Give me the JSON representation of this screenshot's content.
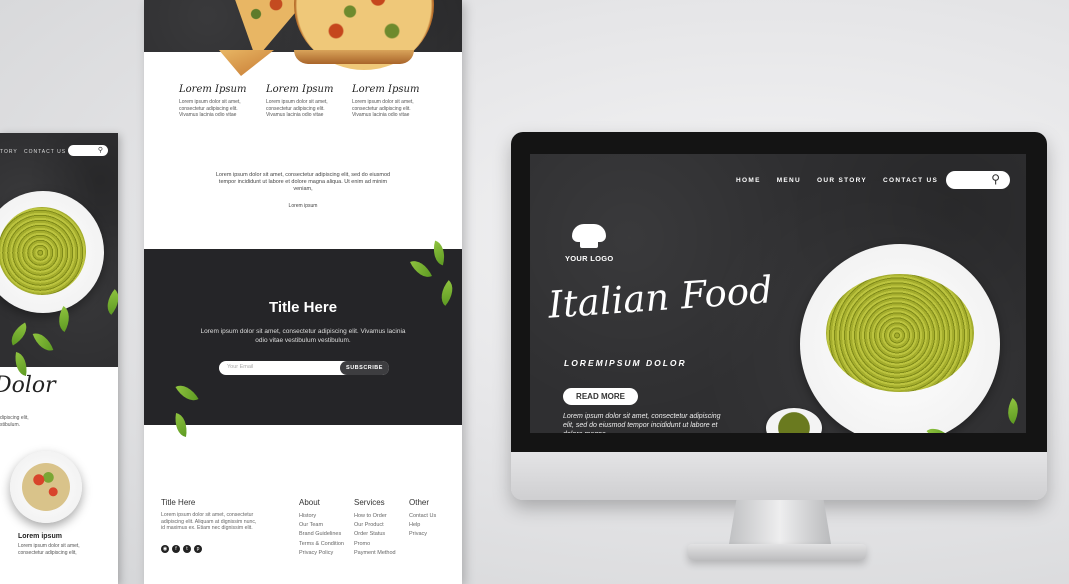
{
  "left_mockup": {
    "nav_partial": "TORY",
    "nav_contact": "CONTACT US",
    "dolor_partial": "Dolor",
    "body_partial_1": "dipiscing elit,",
    "body_partial_2": "stibulum.",
    "product_title": "Lorem ipsum",
    "product_text_1": "Lorem ipsum dolor sit amet,",
    "product_text_2": "consectetur adipiscing elit,"
  },
  "middle_mockup": {
    "features": [
      {
        "title": "Lorem Ipsum",
        "text": "Lorem ipsum dolor sit amet, consectetur adipiscing elit. Vivamus lacinia odio vitae"
      },
      {
        "title": "Lorem Ipsum",
        "text": "Lorem ipsum dolor sit amet, consectetur adipiscing elit. Vivamus lacinia odio vitae"
      },
      {
        "title": "Lorem Ipsum",
        "text": "Lorem ipsum dolor sit amet, consectetur adipiscing elit. Vivamus lacinia odio vitae"
      }
    ],
    "about_text": "Lorem ipsum dolor sit amet, consectetur adipiscing elit, sed do eiusmod tempor incididunt ut labore et dolore magna aliqua. Ut enim ad minim veniam,",
    "about_sign": "Lorem ipsum",
    "newsletter_title": "Title Here",
    "newsletter_text": "Lorem ipsum dolor sit amet, consectetur adipiscing elit. Vivamus lacinia odio vitae vestibulum vestibulum.",
    "email_placeholder": "Your Email",
    "subscribe_label": "SUBSCRIBE",
    "footer": {
      "title": "Title Here",
      "text": "Lorem ipsum dolor sit amet, consectetur adipiscing elit. Aliquam at dignissim nunc, id maximus ex. Etiam nec dignissim elit.",
      "about_heading": "About",
      "about_links": [
        "History",
        "Our Team",
        "Brand Guidelines",
        "Terms & Condition",
        "Privacy Policy"
      ],
      "services_heading": "Services",
      "services_links": [
        "How to Order",
        "Our Product",
        "Order Status",
        "Promo",
        "Payment Method"
      ],
      "other_heading": "Other",
      "other_links": [
        "Contact Us",
        "Help",
        "Privacy"
      ],
      "social_icons": [
        "instagram-icon",
        "facebook-icon",
        "twitter-icon",
        "pinterest-icon"
      ]
    }
  },
  "desktop_mockup": {
    "nav": [
      "HOME",
      "MENU",
      "OUR STORY",
      "CONTACT US"
    ],
    "search_placeholder": "",
    "logo_text": "YOUR LOGO",
    "hero_title": "Italian Food",
    "subtitle": "LOREMIPSUM DOLOR",
    "cta_label": "READ MORE",
    "body_text": "Lorem ipsum dolor sit amet, consectetur adipiscing elit, sed do eiusmod tempor incididunt ut labore et dolore magna"
  },
  "colors": {
    "dark_panel": "#2f2f31",
    "pasta": "#a4ad2d",
    "leaf": "#6faa2c",
    "monitor_frame": "#1a1a1a"
  }
}
